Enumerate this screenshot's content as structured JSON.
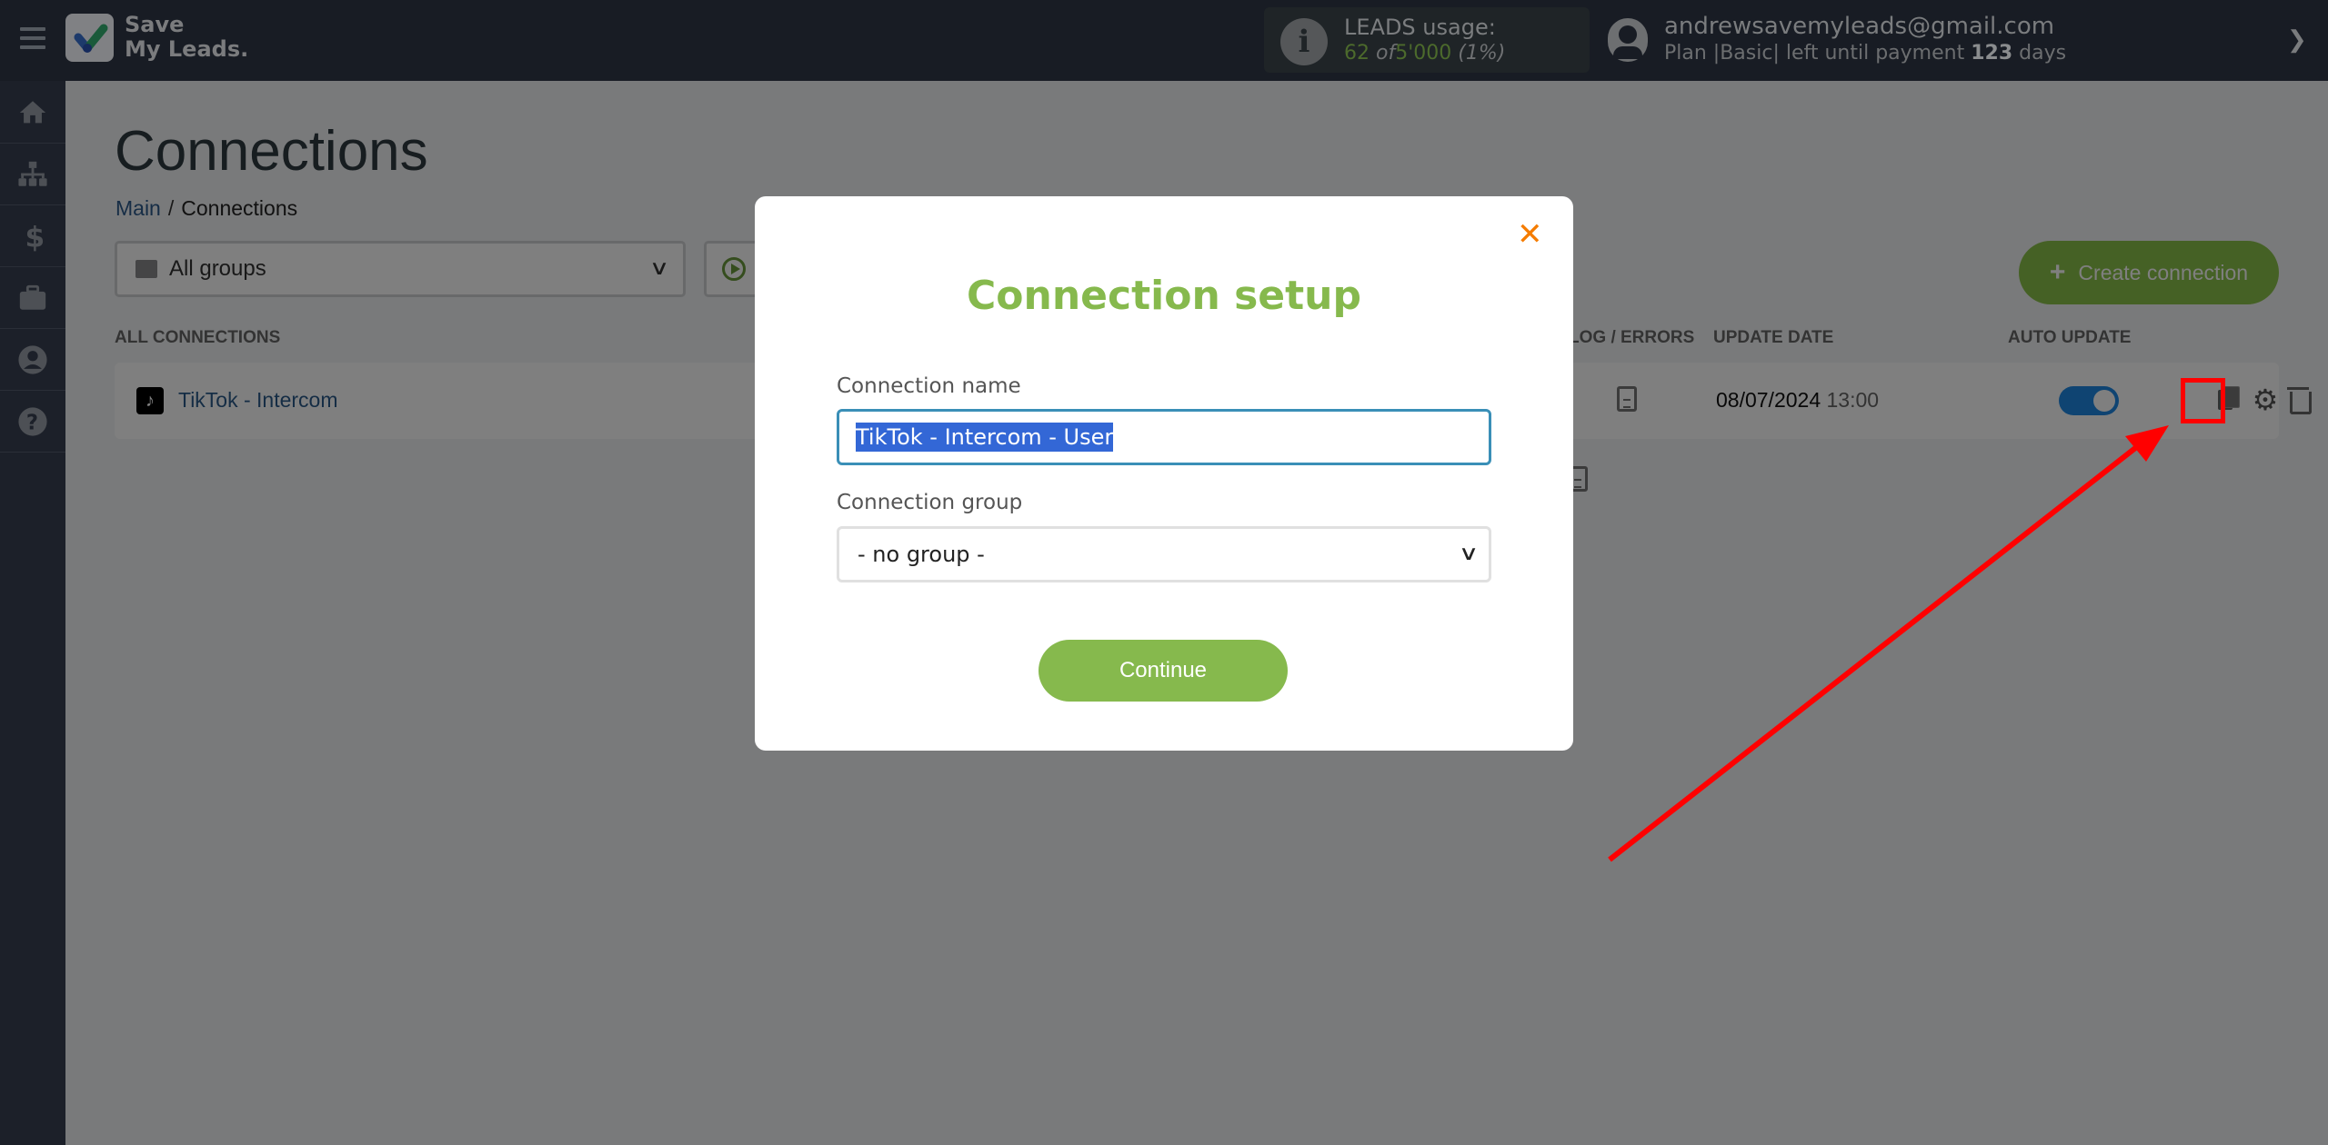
{
  "header": {
    "logo_line1": "Save",
    "logo_line2": "My Leads.",
    "usage_title": "LEADS usage:",
    "usage_used": "62",
    "usage_of": "of",
    "usage_total": "5'000",
    "usage_percent": "(1%)",
    "user_email": "andrewsavemyleads@gmail.com",
    "plan_prefix": "Plan |Basic| left until payment",
    "plan_days": "123",
    "plan_suffix": "days"
  },
  "sidebar": {
    "items": [
      {
        "icon": "home-icon"
      },
      {
        "icon": "sitemap-icon"
      },
      {
        "icon": "dollar-icon"
      },
      {
        "icon": "briefcase-icon"
      },
      {
        "icon": "user-circle-icon"
      },
      {
        "icon": "help-icon"
      }
    ]
  },
  "page": {
    "title": "Connections",
    "breadcrumb": {
      "main": "Main",
      "separator": "/",
      "current": "Connections"
    },
    "group_filter": "All groups",
    "create_button": "Create connection",
    "columns": {
      "all_connections": "ALL CONNECTIONS",
      "log_errors": "LOG / ERRORS",
      "update_date": "UPDATE DATE",
      "auto_update": "AUTO UPDATE"
    },
    "rows": [
      {
        "name": "TikTok - Intercom",
        "date": "08/07/2024",
        "time": "13:00",
        "auto_update": true
      }
    ]
  },
  "modal": {
    "title": "Connection setup",
    "close_glyph": "✕",
    "name_label": "Connection name",
    "name_value": "TikTok - Intercom - User",
    "group_label": "Connection group",
    "group_value": "- no group -",
    "continue_label": "Continue"
  },
  "colors": {
    "accent_green": "#86b94d",
    "close_orange": "#f57c00",
    "annotation_red": "#ff0000",
    "toggle_blue": "#1e88e5"
  }
}
